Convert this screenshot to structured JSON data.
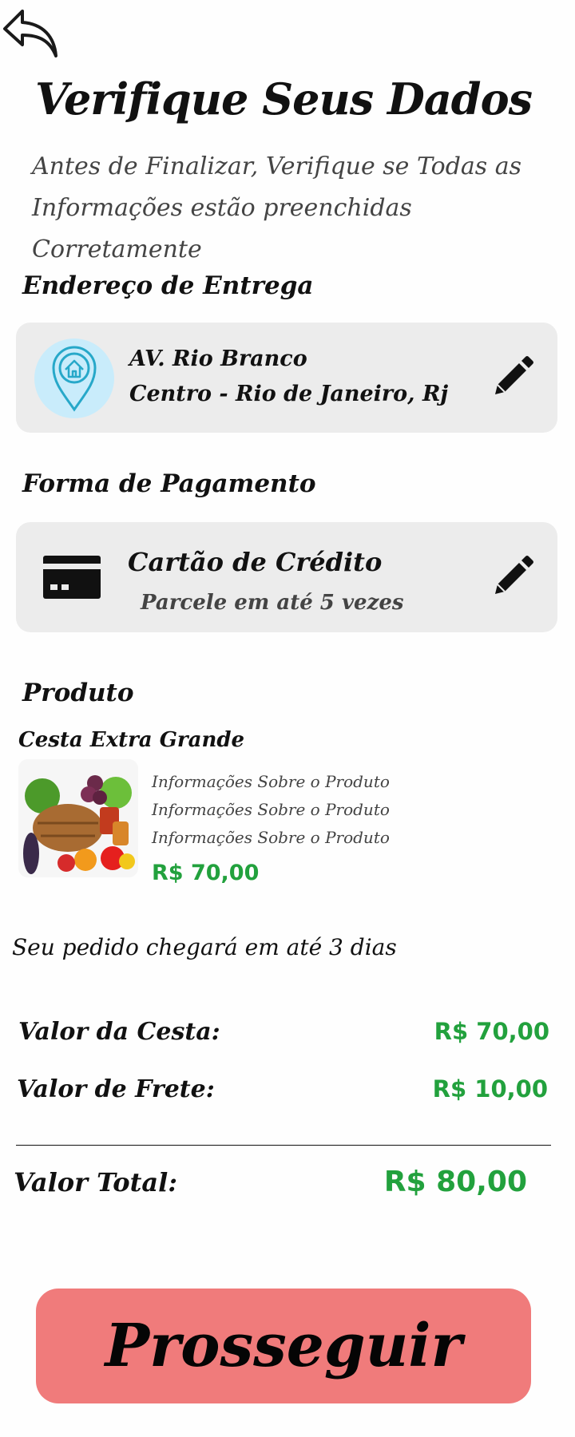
{
  "header": {
    "title": "Verifique Seus Dados",
    "subtitle": "Antes de Finalizar, Verifique se Todas as Informações estão preenchidas Corretamente"
  },
  "address": {
    "section_title": "Endereço de Entrega",
    "line1": "AV. Rio Branco",
    "line2": "Centro - Rio de Janeiro, Rj"
  },
  "payment": {
    "section_title": "Forma de Pagamento",
    "method": "Cartão de Crédito",
    "installments": "Parcele em até 5 vezes"
  },
  "product": {
    "section_title": "Produto",
    "name": "Cesta Extra Grande",
    "description": "Informações Sobre o Produto Informações Sobre o Produto Informações Sobre o Produto",
    "price": "R$ 70,00"
  },
  "delivery_note": "Seu pedido chegará em até 3 dias",
  "summary": {
    "basket_label": "Valor da Cesta:",
    "basket_value": "R$ 70,00",
    "shipping_label": "Valor de Frete:",
    "shipping_value": "R$ 10,00",
    "total_label": "Valor Total:",
    "total_value": "R$ 80,00"
  },
  "proceed_button": "Prosseguir",
  "colors": {
    "price": "#22a13d",
    "button": "#f07b7b",
    "card": "#ececec",
    "pin_bg": "#c9ecfb"
  },
  "icons": [
    "back-arrow-icon",
    "location-pin-icon",
    "credit-card-icon",
    "pencil-icon"
  ]
}
